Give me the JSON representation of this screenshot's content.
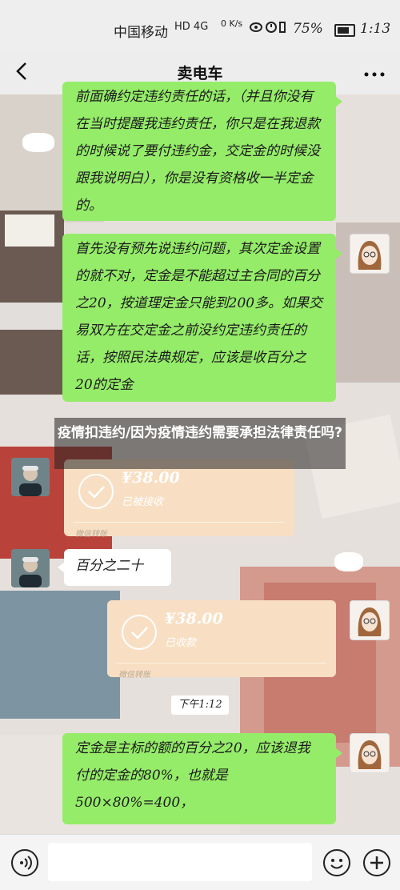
{
  "status_bar": {
    "carrier": "中国移动",
    "signal": "HD 4G",
    "net_speed": "0 K/s",
    "battery": "75%",
    "time": "1:13"
  },
  "header": {
    "title": "卖电车",
    "back_icon": "chevron-left-icon",
    "more_icon": "more-dots-icon"
  },
  "messages": [
    {
      "side": "right",
      "type": "text",
      "text": "前面确约定违约责任的话，（并且你没有在当时提醒我违约责任，你只是在我退款的时候说了要付违约金，交定金的时候没跟我说明白），你是没有资格收一半定金的。"
    },
    {
      "side": "right",
      "type": "text",
      "text": "首先没有预先说违约问题，其次定金设置的就不对，定金是不能超过主合同的百分之20，按道理定金只能到200多。如果交易双方在交定金之前没约定违约责任的话，按照民法典规定，应该是收百分之20的定金"
    },
    {
      "side": "left",
      "type": "transfer",
      "amount": "¥38.00",
      "status": "已被接收",
      "footer": "微信转账"
    },
    {
      "side": "left",
      "type": "text",
      "text": "百分之二十"
    },
    {
      "side": "right",
      "type": "transfer",
      "amount": "¥38.00",
      "status": "已收款",
      "footer": "微信转账"
    },
    {
      "type": "timestamp",
      "text": "下午1:12"
    },
    {
      "side": "right",
      "type": "text",
      "text": "定金是主标的额的百分之20，应该退我付的定金的80%，也就是500×80%=400，"
    }
  ],
  "overlay_title": "疫情扣违约/因为疫情违约需要承担法律责任吗?",
  "input_bar": {
    "voice_icon": "voice-icon",
    "emoji_icon": "emoji-icon",
    "plus_icon": "plus-icon"
  },
  "colors": {
    "green_bubble": "#95ec69",
    "transfer_bg": "#f8dfc3",
    "header_bg": "#ededed"
  }
}
